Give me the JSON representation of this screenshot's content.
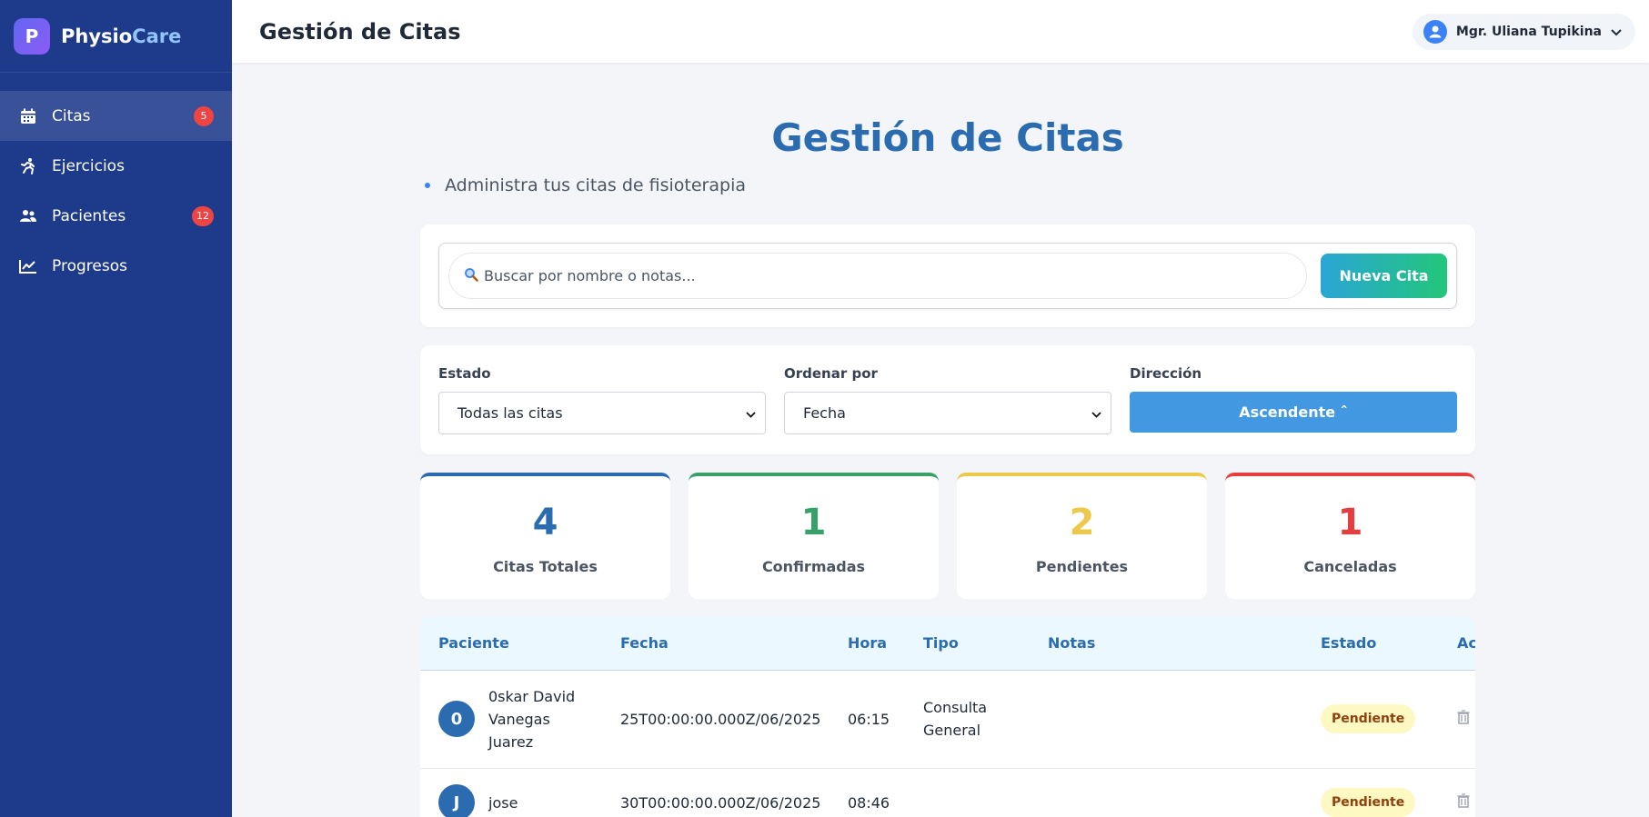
{
  "brand": {
    "logo_letter": "P",
    "name_part1": "Physio",
    "name_part2": "Care"
  },
  "sidebar": {
    "items": [
      {
        "label": "Citas",
        "icon": "calendar-icon",
        "badge": "5",
        "active": true
      },
      {
        "label": "Ejercicios",
        "icon": "running-icon",
        "badge": null,
        "active": false
      },
      {
        "label": "Pacientes",
        "icon": "users-icon",
        "badge": "12",
        "active": false
      },
      {
        "label": "Progresos",
        "icon": "chart-line-icon",
        "badge": null,
        "active": false
      }
    ]
  },
  "header": {
    "title": "Gestión de Citas",
    "user_name": "Mgr. Uliana Tupikina"
  },
  "main": {
    "title": "Gestión de Citas",
    "subtitle": "Administra tus citas de fisioterapia",
    "search_placeholder": "Buscar por nombre o notas...",
    "new_button": "Nueva Cita",
    "filters": {
      "estado_label": "Estado",
      "estado_value": "Todas las citas",
      "orden_label": "Ordenar por",
      "orden_value": "Fecha",
      "direccion_label": "Dirección",
      "direccion_value": "Ascendente ˆ"
    },
    "stats": [
      {
        "value": "4",
        "label": "Citas Totales",
        "color": "#2b6cb0"
      },
      {
        "value": "1",
        "label": "Confirmadas",
        "color": "#38a169"
      },
      {
        "value": "2",
        "label": "Pendientes",
        "color": "#ecc94b"
      },
      {
        "value": "1",
        "label": "Canceladas",
        "color": "#e53e3e"
      }
    ],
    "table": {
      "headers": [
        "Paciente",
        "Fecha",
        "Hora",
        "Tipo",
        "Notas",
        "Estado",
        "Ac"
      ],
      "rows": [
        {
          "initial": "0",
          "paciente": "0skar David Vanegas Juarez",
          "fecha": "25T00:00:00.000Z/06/2025",
          "hora": "06:15",
          "tipo": "Consulta General",
          "notas": "",
          "estado": "Pendiente"
        },
        {
          "initial": "J",
          "paciente": "jose",
          "fecha": "30T00:00:00.000Z/06/2025",
          "hora": "08:46",
          "tipo": "",
          "notas": "",
          "estado": "Pendiente"
        }
      ]
    }
  },
  "colors": {
    "sidebar": "#1e3a8a",
    "accent": "#2b6cb0",
    "badge": "#ef4444"
  }
}
